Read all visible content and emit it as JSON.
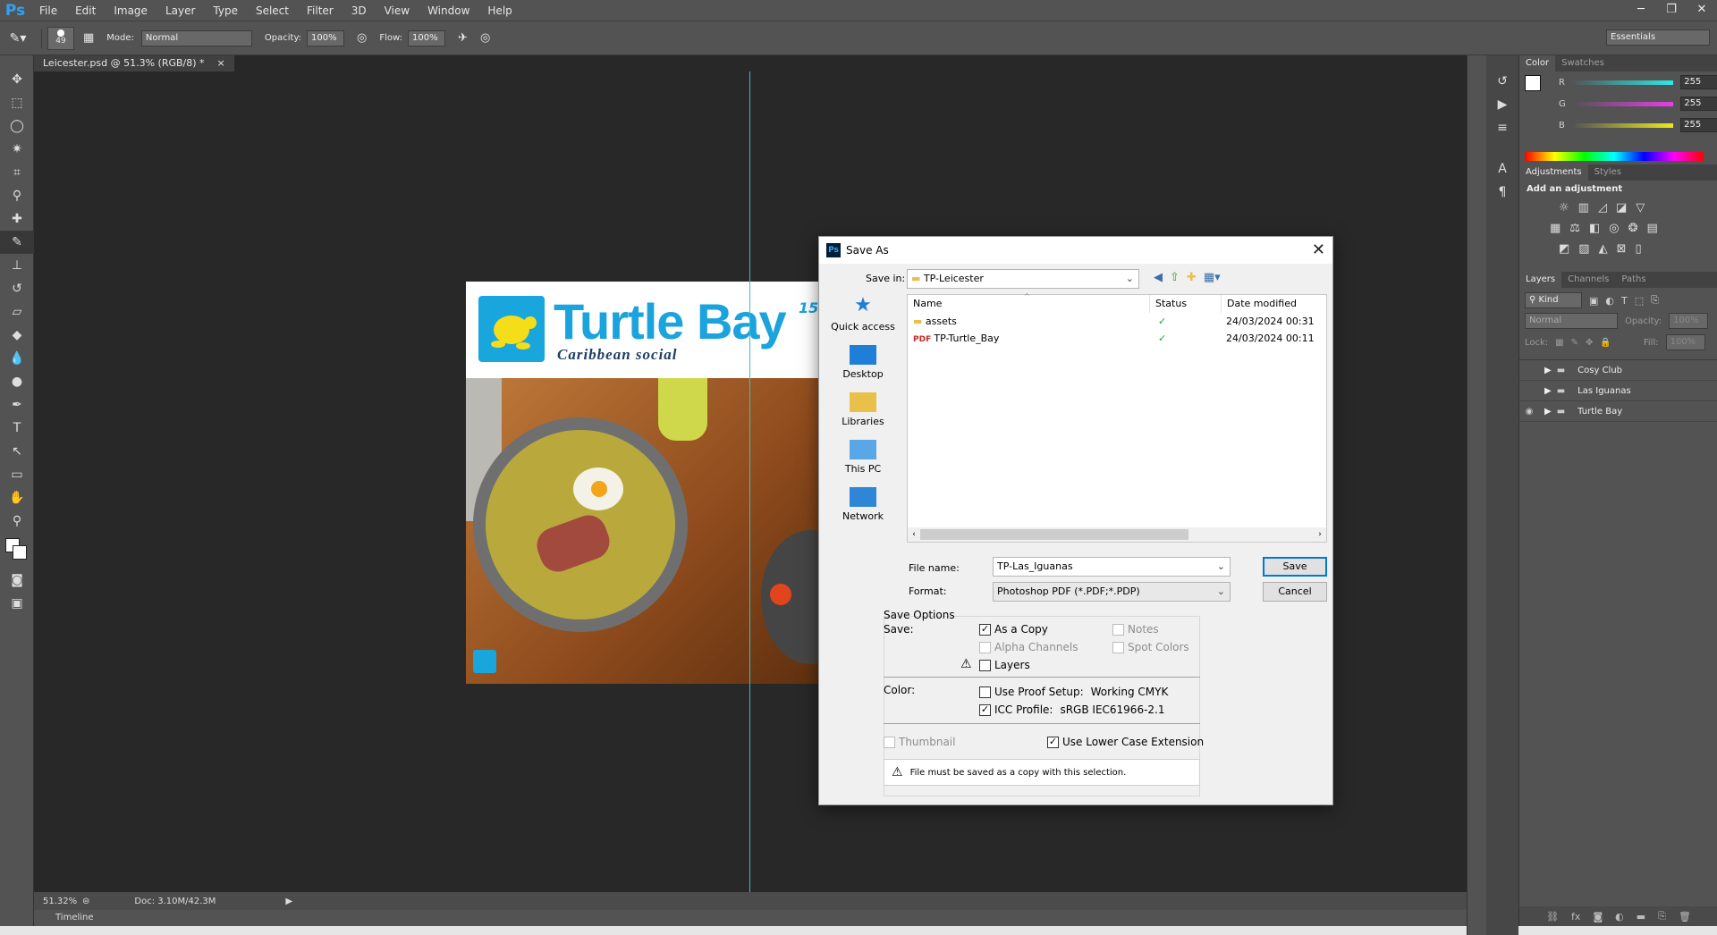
{
  "app": {
    "logo": "Ps",
    "menu": [
      "File",
      "Edit",
      "Image",
      "Layer",
      "Type",
      "Select",
      "Filter",
      "3D",
      "View",
      "Window",
      "Help"
    ]
  },
  "window_controls": {
    "minimize": "─",
    "restore": "❐",
    "close": "✕"
  },
  "options_bar": {
    "brush_size": "49",
    "mode_label": "Mode:",
    "mode_value": "Normal",
    "opacity_label": "Opacity:",
    "opacity_value": "100%",
    "flow_label": "Flow:",
    "flow_value": "100%",
    "workspace": "Essentials"
  },
  "document": {
    "tab_title": "Leicester.psd @ 51.3% (RGB/8) *",
    "tab_close": "×"
  },
  "status": {
    "zoom": "51.32%",
    "doc": "Doc: 3.10M/42.3M"
  },
  "timeline": {
    "label": "Timeline"
  },
  "artwork": {
    "brand": "Turtle Bay",
    "tagline": "Caribbean social",
    "side_number": "15"
  },
  "color_panel": {
    "tabs": [
      "Color",
      "Swatches"
    ],
    "channels": [
      {
        "label": "R",
        "value": "255",
        "color": "#2ee8e8"
      },
      {
        "label": "G",
        "value": "255",
        "color": "#e83ee8"
      },
      {
        "label": "B",
        "value": "255",
        "color": "#eee81e"
      }
    ]
  },
  "adjustments_panel": {
    "tabs": [
      "Adjustments",
      "Styles"
    ],
    "heading": "Add an adjustment"
  },
  "layers_panel": {
    "tabs": [
      "Layers",
      "Channels",
      "Paths"
    ],
    "kind": "Kind",
    "blend": "Normal",
    "opacity_label": "Opacity:",
    "opacity_value": "100%",
    "lock_label": "Lock:",
    "fill_label": "Fill:",
    "fill_value": "100%",
    "layers": [
      {
        "name": "Cosy Club",
        "visible": false
      },
      {
        "name": "Las Iguanas",
        "visible": false
      },
      {
        "name": "Turtle Bay",
        "visible": true
      }
    ]
  },
  "dialog": {
    "title": "Save As",
    "save_in_label": "Save in:",
    "save_in_value": "TP-Leicester",
    "places": [
      "Quick access",
      "Desktop",
      "Libraries",
      "This PC",
      "Network"
    ],
    "columns": [
      "Name",
      "Status",
      "Date modified"
    ],
    "files": [
      {
        "name": "assets",
        "date": "24/03/2024 00:31"
      },
      {
        "name": "TP-Turtle_Bay",
        "date": "24/03/2024 00:11"
      }
    ],
    "file_name_label": "File name:",
    "file_name_value": "TP-Las_Iguanas",
    "format_label": "Format:",
    "format_value": "Photoshop PDF (*.PDF;*.PDP)",
    "save_button": "Save",
    "cancel_button": "Cancel",
    "save_options_heading": "Save Options",
    "save_label": "Save:",
    "opt_as_copy": "As a Copy",
    "opt_notes": "Notes",
    "opt_alpha": "Alpha Channels",
    "opt_spot": "Spot Colors",
    "opt_layers": "Layers",
    "color_label": "Color:",
    "opt_proof": "Use Proof Setup:",
    "proof_value": "Working CMYK",
    "opt_icc": "ICC Profile:",
    "icc_value": "sRGB IEC61966-2.1",
    "opt_thumbnail": "Thumbnail",
    "opt_lowercase": "Use Lower Case Extension",
    "warning": "File must be saved as a copy with this selection."
  }
}
